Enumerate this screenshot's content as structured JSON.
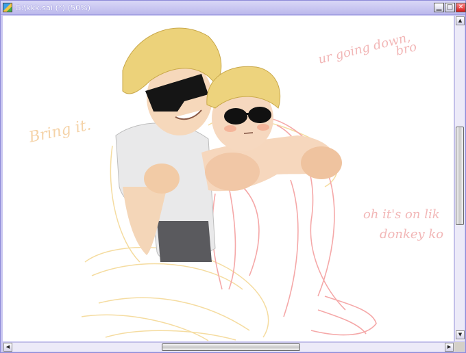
{
  "window": {
    "title": "G:\\kkk.sai (*) (50%)",
    "accent_color": "#bcb9ec",
    "title_text_color": "#ffffff"
  },
  "controls": {
    "minimize_icon": "minimize-icon",
    "maximize_icon": "maximize-icon",
    "close_icon": "close-icon",
    "minimize_glyph": "▁",
    "maximize_glyph": "□",
    "close_glyph": "✕"
  },
  "scrollbars": {
    "up_glyph": "▲",
    "down_glyph": "▼",
    "left_glyph": "◀",
    "right_glyph": "▶"
  },
  "artwork": {
    "caption_left": "Bring it.",
    "caption_top_line1": "ur going down,",
    "caption_top_line2": "bro",
    "caption_right_line1": "oh it's on lik",
    "caption_right_line2": "donkey ko"
  }
}
